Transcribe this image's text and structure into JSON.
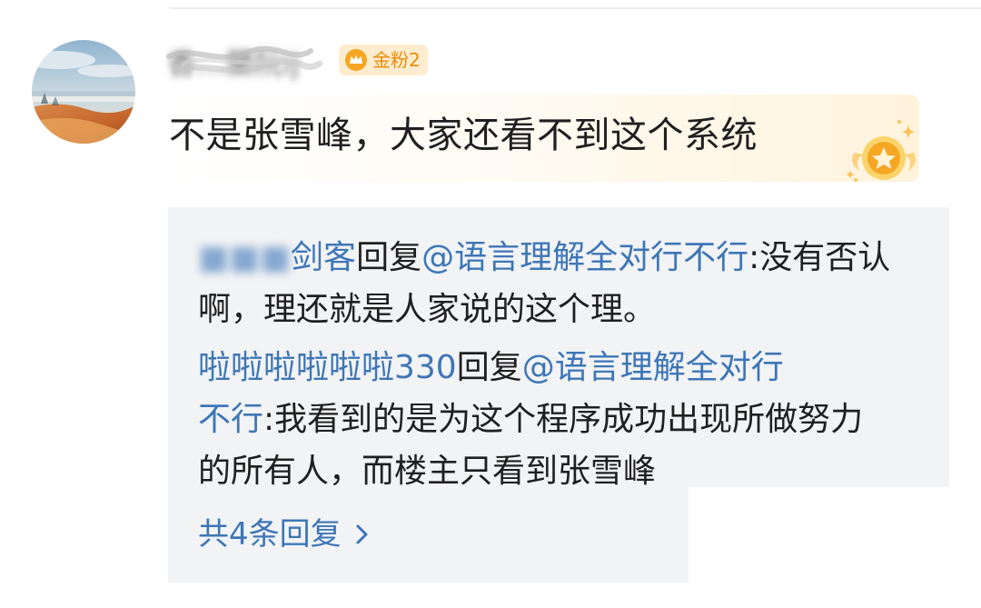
{
  "post": {
    "username": "香…蘭阮ij",
    "badge": {
      "label": "金粉2",
      "icon": "crown-icon"
    },
    "comment": "不是张雪峰，大家还看不到这个系统",
    "medal_icon": "gold-fan-medal-icon"
  },
  "replies": [
    {
      "line1": {
        "author": "剑客",
        "verb": "回复",
        "target": "@语言理解全对行不行",
        "colon": ":",
        "text": "没有否认"
      },
      "line2": "啊，理还就是人家说的这个理。"
    },
    {
      "line1": {
        "author": "啦啦啦啦啦啦330",
        "verb": "回复",
        "target": "@语言理解全对行"
      },
      "line2": {
        "target_end": "不行",
        "colon": ":",
        "text": "我看到的是为这个程序成功出现所做努力"
      },
      "line3": "的所有人，而楼主只看到张雪峰"
    }
  ],
  "more_replies_label": "共4条回复",
  "colors": {
    "link": "#3d76b6",
    "text": "#1f1f1f",
    "reply_bg": "#f2f3f5",
    "badge_bg": "#fdeccd",
    "badge_text": "#e88a0b"
  }
}
